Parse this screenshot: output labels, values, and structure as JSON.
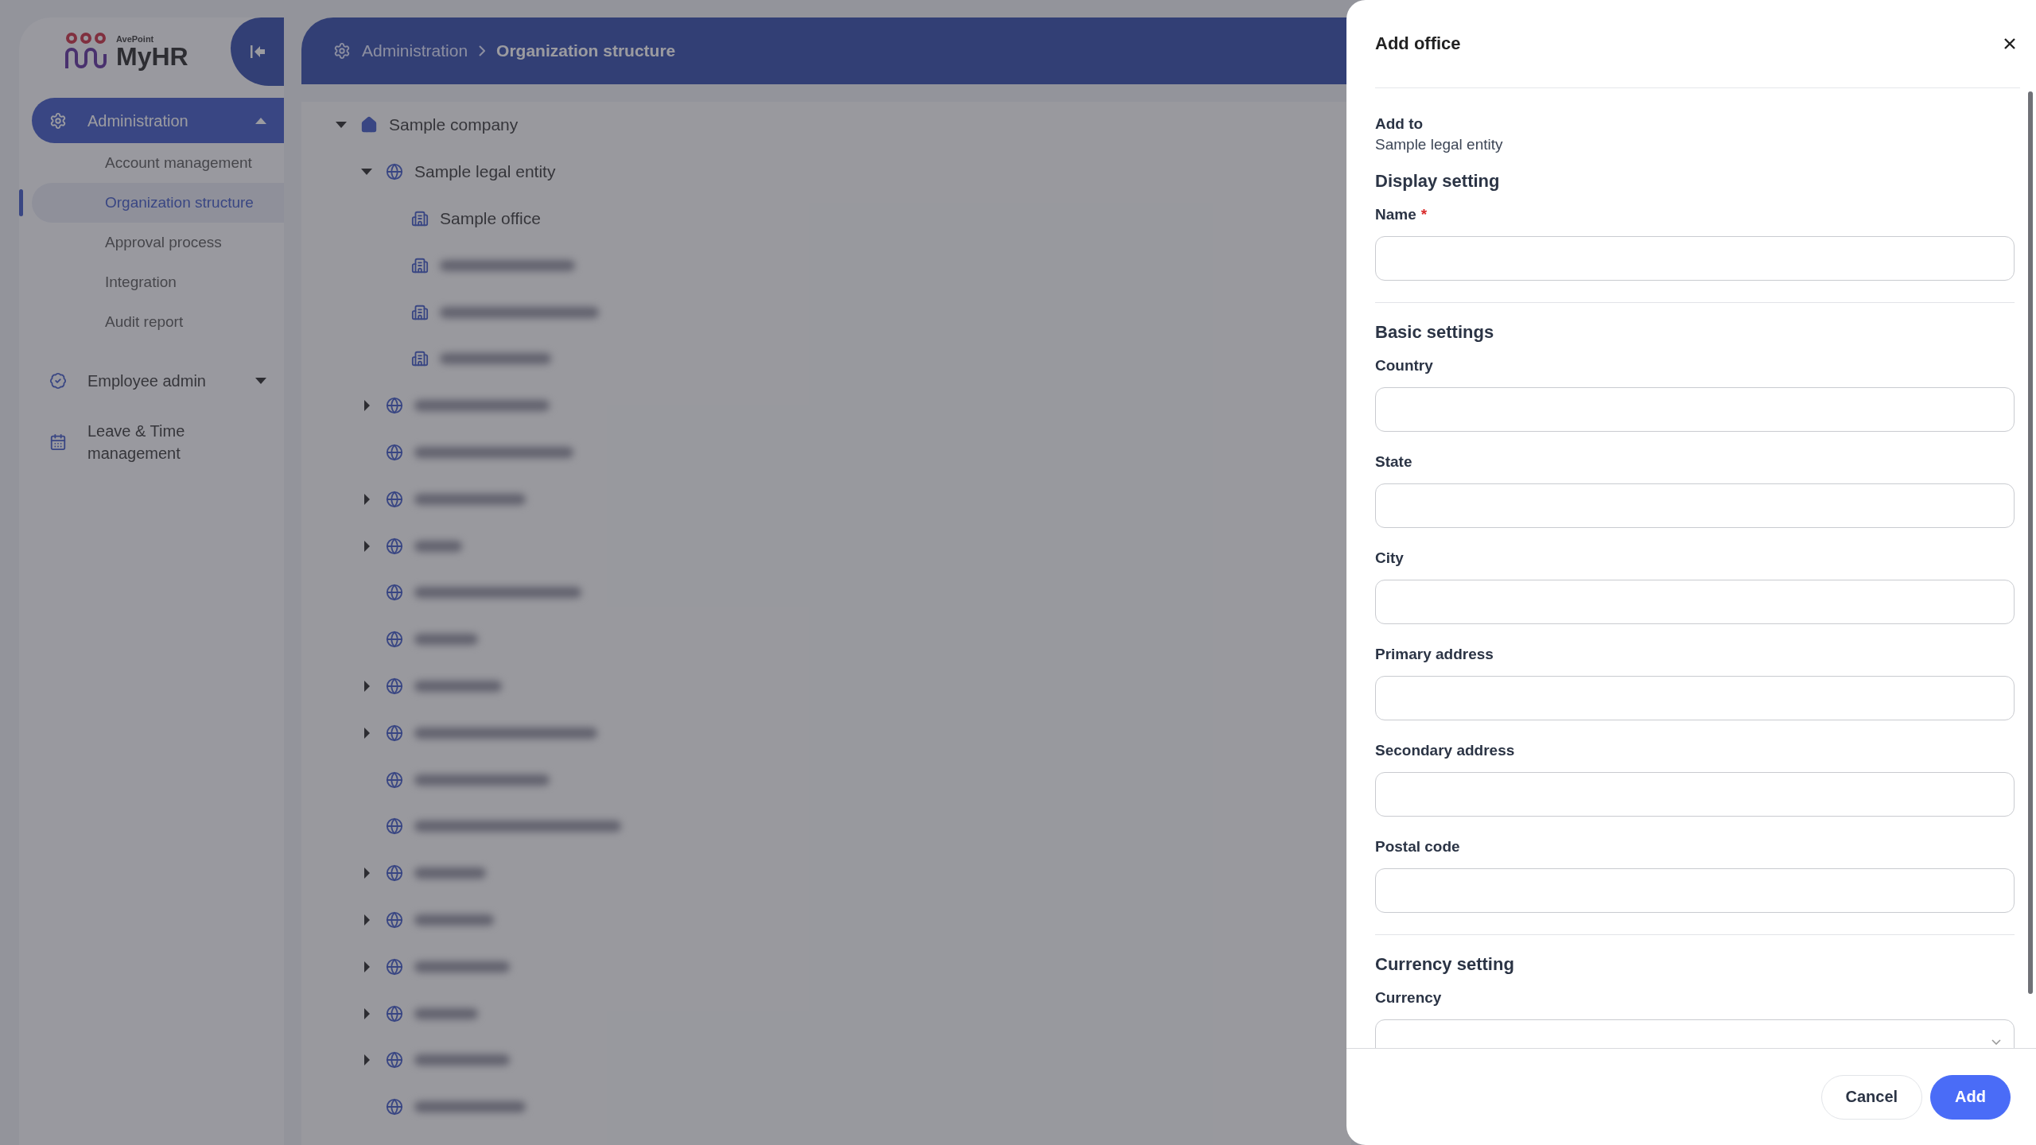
{
  "sidebar": {
    "brand": {
      "vendor": "AvePoint",
      "name": "MyHR"
    },
    "items": [
      {
        "label": "Administration",
        "expanded": true,
        "selected": true,
        "children": [
          {
            "label": "Account management",
            "selected": false
          },
          {
            "label": "Organization structure",
            "selected": true
          },
          {
            "label": "Approval process",
            "selected": false
          },
          {
            "label": "Integration",
            "selected": false
          },
          {
            "label": "Audit report",
            "selected": false
          }
        ]
      },
      {
        "label": "Employee admin",
        "expanded": false,
        "selected": false
      },
      {
        "label": "Leave & Time management",
        "selected": false
      }
    ]
  },
  "breadcrumb": [
    {
      "label": "Administration",
      "current": false
    },
    {
      "label": "Organization structure",
      "current": true
    }
  ],
  "tree": [
    {
      "label": "Sample company",
      "kind": "company",
      "has_children": true,
      "expanded": true,
      "children": [
        {
          "label": "Sample legal entity",
          "kind": "entity",
          "has_children": true,
          "expanded": true,
          "children": [
            {
              "label": "Sample office",
              "kind": "office",
              "has_children": false
            },
            {
              "kind": "office",
              "has_children": false,
              "blurred": true
            },
            {
              "kind": "office",
              "has_children": false,
              "blurred": true
            },
            {
              "kind": "office",
              "has_children": false,
              "blurred": true
            }
          ]
        },
        {
          "kind": "entity",
          "has_children": true,
          "expanded": false,
          "blurred": true
        },
        {
          "kind": "entity",
          "has_children": false,
          "blurred": true
        },
        {
          "kind": "entity",
          "has_children": true,
          "expanded": false,
          "blurred": true
        },
        {
          "kind": "entity",
          "has_children": true,
          "expanded": false,
          "blurred": true
        },
        {
          "kind": "entity",
          "has_children": false,
          "blurred": true
        },
        {
          "kind": "entity",
          "has_children": false,
          "blurred": true
        },
        {
          "kind": "entity",
          "has_children": true,
          "expanded": false,
          "blurred": true
        },
        {
          "kind": "entity",
          "has_children": true,
          "expanded": false,
          "blurred": true
        },
        {
          "kind": "entity",
          "has_children": false,
          "blurred": true
        },
        {
          "kind": "entity",
          "has_children": false,
          "blurred": true
        },
        {
          "kind": "entity",
          "has_children": true,
          "expanded": false,
          "blurred": true
        },
        {
          "kind": "entity",
          "has_children": true,
          "expanded": false,
          "blurred": true
        },
        {
          "kind": "entity",
          "has_children": true,
          "expanded": false,
          "blurred": true
        },
        {
          "kind": "entity",
          "has_children": true,
          "expanded": false,
          "blurred": true
        },
        {
          "kind": "entity",
          "has_children": true,
          "expanded": false,
          "blurred": true
        },
        {
          "kind": "entity",
          "has_children": false,
          "blurred": true
        }
      ]
    }
  ],
  "drawer": {
    "title": "Add office",
    "add_to": {
      "label": "Add to",
      "value": "Sample legal entity"
    },
    "sections": [
      {
        "title": "Display setting",
        "fields": [
          {
            "label": "Name",
            "required_mark": "*",
            "kind": "text"
          }
        ]
      },
      {
        "title": "Basic settings",
        "fields": [
          {
            "label": "Country",
            "kind": "text"
          },
          {
            "label": "State",
            "kind": "text"
          },
          {
            "label": "City",
            "kind": "text"
          },
          {
            "label": "Primary address",
            "kind": "text"
          },
          {
            "label": "Secondary address",
            "kind": "text"
          },
          {
            "label": "Postal code",
            "kind": "text"
          }
        ]
      },
      {
        "title": "Currency setting",
        "fields": [
          {
            "label": "Currency",
            "kind": "select"
          }
        ]
      }
    ],
    "buttons": [
      {
        "label": "Cancel",
        "kind": "secondary"
      },
      {
        "label": "Add",
        "kind": "primary"
      }
    ]
  }
}
